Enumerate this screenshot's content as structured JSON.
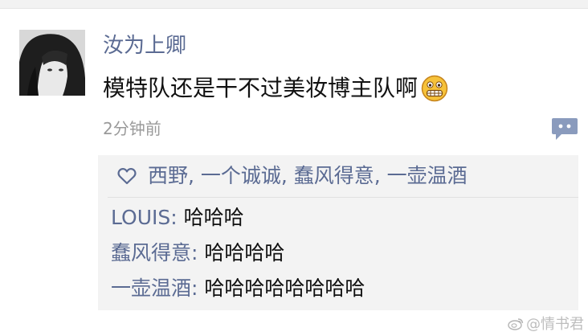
{
  "post": {
    "username": "汝为上卿",
    "message": "模特队还是干不过美妆博主队啊",
    "emoji": "grimacing-face-emoji",
    "timestamp": "2分钟前"
  },
  "icons": {
    "comment": "comment-bubble-icon",
    "heart": "heart-icon"
  },
  "likes": {
    "text": "西野, 一个诚诚, 蠢风得意, 一壶温酒"
  },
  "comments": [
    {
      "author": "LOUIS",
      "text": "哈哈哈"
    },
    {
      "author": "蠢风得意",
      "text": "哈哈哈哈"
    },
    {
      "author": "一壶温酒",
      "text": "哈哈哈哈哈哈哈哈"
    }
  ],
  "watermark": {
    "text": "@情书君"
  },
  "colors": {
    "nickname": "#5b6b93",
    "comment_box_bg": "#f3f3f3",
    "timestamp": "#9a9a9a"
  }
}
